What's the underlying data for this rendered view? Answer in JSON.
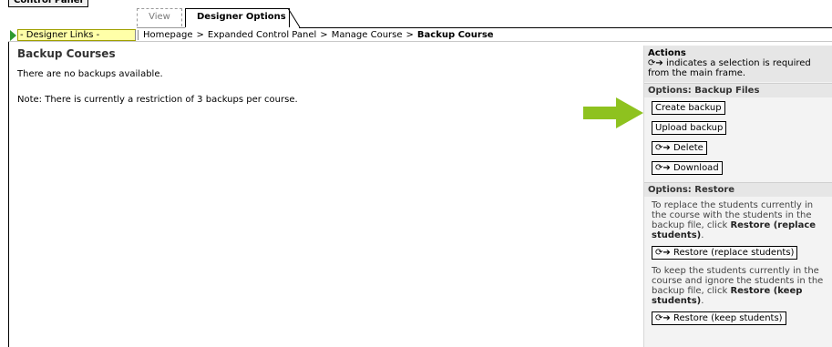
{
  "top": {
    "control_panel_label": "Control Panel",
    "tab_view": "View",
    "tab_designer": "Designer Options"
  },
  "breadcrumb": {
    "designer_links": "- Designer Links -",
    "crumb1": "Homepage",
    "crumb2": "Expanded Control Panel",
    "crumb3": "Manage Course",
    "current": "Backup Course",
    "separator": ">"
  },
  "main": {
    "title": "Backup Courses",
    "no_backups": "There are no backups available.",
    "note": "Note: There is currently a restriction of 3 backups per course."
  },
  "panel": {
    "actions_heading": "Actions",
    "actions_note": "indicates a selection is required from the main frame.",
    "backup_heading": "Options: Backup Files",
    "create_backup": "Create backup",
    "upload_backup": "Upload backup",
    "delete": "Delete",
    "download": "Download",
    "restore_heading": "Options: Restore",
    "replace_text_1": "To replace the students currently in the course with the students in the backup file, click ",
    "replace_bold": "Restore (replace students)",
    "replace_end": ".",
    "restore_replace": "Restore (replace students)",
    "keep_text_1": "To keep the students currently in the course and ignore the students in the backup file, click ",
    "keep_bold": "Restore (keep students)",
    "keep_end": ".",
    "restore_keep": "Restore (keep students)"
  },
  "colors": {
    "arrow": "#8ec21f",
    "designer_links_bg": "#ffffa8",
    "panel_bg": "#f3f3f3"
  },
  "icons": {
    "selection_required": "selection-arrow-icon",
    "play": "play-icon"
  }
}
